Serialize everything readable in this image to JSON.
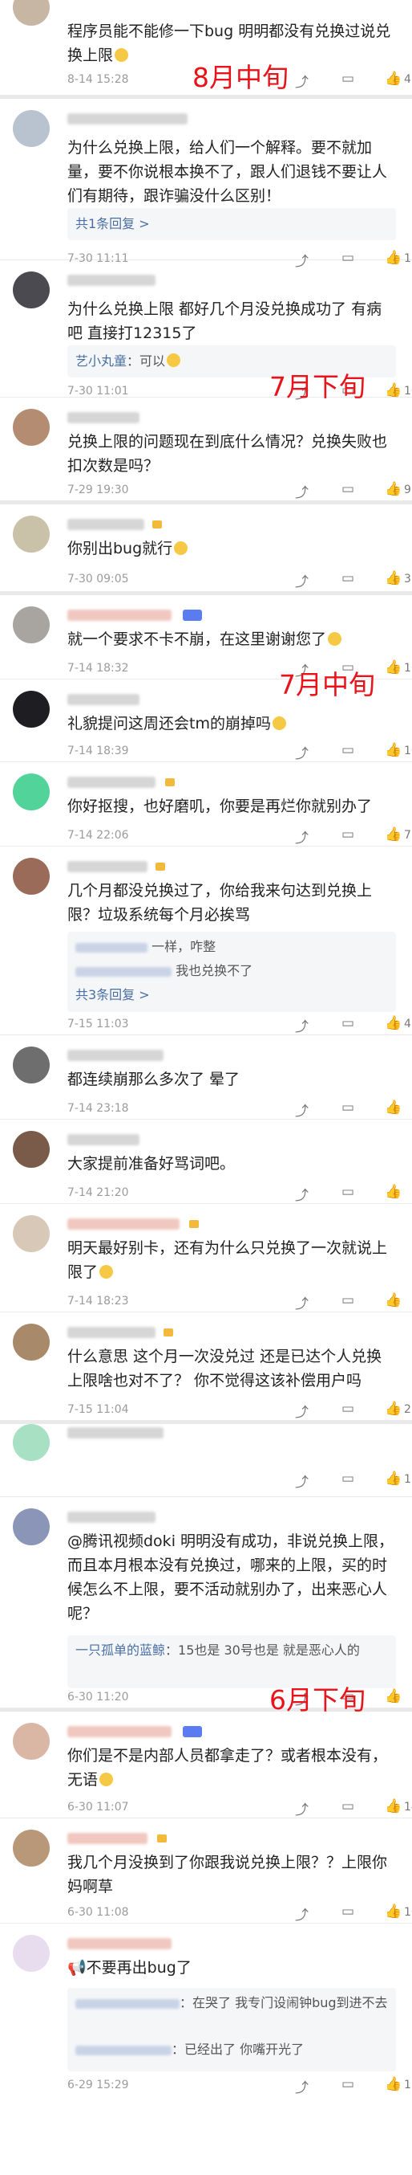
{
  "comments": [
    {
      "text": "程序员能不能修一下bug 明明都没有兑换过说兑换上限",
      "time": "8-14 15:28",
      "likes": "4"
    },
    {
      "text": "为什么兑换上限，给人们一个解释。要不就加量，要不你说根本换不了，跟人们退钱不要让人们有期待，跟诈骗没什么区别！",
      "time": "7-30 11:11",
      "likes": "13",
      "replies_label": "共1条回复 >"
    },
    {
      "text": "为什么兑换上限 都好几个月没兑换成功了 有病吧 直接打12315了",
      "time": "7-30 11:01",
      "likes": "10",
      "reply_text": "：可以"
    },
    {
      "text": "兑换上限的问题现在到底什么情况？兑换失败也扣次数是吗？",
      "time": "7-29 19:30",
      "likes": "9"
    },
    {
      "text": "你别出bug就行",
      "time": "7-30 09:05",
      "likes": "3"
    },
    {
      "text": "就一个要求不卡不崩，在这里谢谢您了",
      "time": "7-14 18:32",
      "likes": "16"
    },
    {
      "text": "礼貌提问这周还会tm的崩掉吗",
      "time": "7-14 18:39",
      "likes": "10"
    },
    {
      "text": "你好抠搜，也好磨叽，你要是再烂你就别办了",
      "time": "7-14 22:06",
      "likes": "7"
    },
    {
      "text": "几个月都没兑换过了，你给我来句达到兑换上限？垃圾系统每个月必挨骂",
      "time": "7-15 11:03",
      "likes": "4",
      "reply_lines": [
        "一样，咋整",
        "我也兑换不了"
      ],
      "replies_label": "共3条回复 >"
    },
    {
      "text": "都连续崩那么多次了 晕了",
      "time": "7-14 23:18",
      "likes": ""
    },
    {
      "text": "大家提前准备好骂词吧。",
      "time": "7-14 21:20",
      "likes": ""
    },
    {
      "text": "明天最好别卡，还有为什么只兑换了一次就说上限了",
      "time": "7-14 18:23",
      "likes": ""
    },
    {
      "text": "什么意思 这个月一次没兑过 还是已达个人兑换上限啥也对不了？ 你不觉得这该补偿用户吗",
      "time": "7-15 11:04",
      "likes": "2"
    },
    {
      "text": "@腾讯视频doki 明明没有成功，非说兑换上限，而且本月根本没有兑换过，哪来的上限，买的时候怎么不上限，要不活动就别办了，出来恶心人呢？",
      "time": "6-30 11:20",
      "likes": "",
      "reply_name": "一只孤单的蓝鲸",
      "reply_text": "：15也是 30号也是 就是恶心人的"
    },
    {
      "text": "你们是不是内部人员都拿走了？或者根本没有，无语",
      "time": "6-30 11:07",
      "likes": "14"
    },
    {
      "text": "我几个月没换到了你跟我说兑换上限？？上限你妈啊草",
      "time": "6-30 11:08",
      "likes": "10"
    },
    {
      "text": "不要再出bug了",
      "time": "6-29 15:29",
      "likes": "13",
      "reply_lines": [
        "：在哭了 我专门设闹钟bug到进不去",
        "：已经出了 你嘴开光了"
      ]
    }
  ],
  "partial_likes": "15",
  "annotations": [
    "8月中旬",
    "7月下旬",
    "7月中旬",
    "6月下旬"
  ],
  "reply_name_2": "艺小丸童"
}
